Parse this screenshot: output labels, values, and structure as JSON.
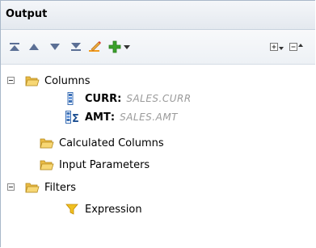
{
  "panel": {
    "title": "Output"
  },
  "toolbar": {
    "buttons": [
      {
        "name": "move-to-top",
        "icon": "move-top-icon"
      },
      {
        "name": "move-up",
        "icon": "arrow-up-icon"
      },
      {
        "name": "move-down",
        "icon": "arrow-down-icon"
      },
      {
        "name": "move-to-bottom",
        "icon": "move-bottom-icon"
      },
      {
        "name": "edit",
        "icon": "pencil-icon"
      },
      {
        "name": "add",
        "icon": "plus-icon"
      },
      {
        "name": "add-menu",
        "icon": "dropdown-arrow-icon"
      },
      {
        "name": "expand-all",
        "icon": "expand-all-icon"
      },
      {
        "name": "collapse-all",
        "icon": "collapse-all-icon"
      }
    ]
  },
  "tree": {
    "columns": {
      "label": "Columns",
      "items": [
        {
          "name": "CURR",
          "sep": ":",
          "source": "SALES.CURR"
        },
        {
          "name": "AMT",
          "sep": ":",
          "source": "SALES.AMT"
        }
      ]
    },
    "calculated_columns": {
      "label": "Calculated Columns"
    },
    "input_parameters": {
      "label": "Input Parameters"
    },
    "filters": {
      "label": "Filters",
      "items": [
        {
          "label": "Expression"
        }
      ]
    }
  },
  "colors": {
    "folder": "#f2c94c",
    "arrow": "#5b6f95",
    "plus": "#3aa12a",
    "filter": "#f0c020",
    "source_text": "#9a9a9a"
  }
}
